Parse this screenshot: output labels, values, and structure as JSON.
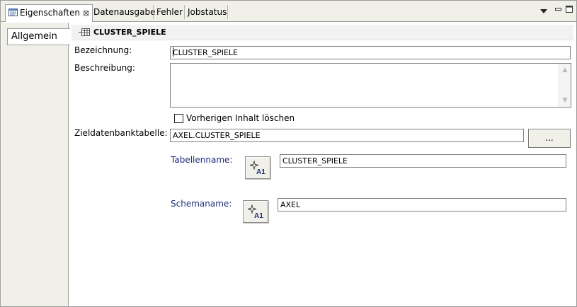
{
  "tabs": [
    {
      "label": "Eigenschaften",
      "active": true
    },
    {
      "label": "Datenausgabe",
      "active": false
    },
    {
      "label": "Fehler",
      "active": false
    },
    {
      "label": "Jobstatus",
      "active": false
    }
  ],
  "side_tabs": [
    {
      "label": "Allgemein"
    }
  ],
  "section": {
    "title": "CLUSTER_SPIELE"
  },
  "form": {
    "bezeichnung_label": "Bezeichnung:",
    "bezeichnung_value": "CLUSTER_SPIELE",
    "beschreibung_label": "Beschreibung:",
    "beschreibung_value": "",
    "checkbox_label": "Vorherigen Inhalt löschen",
    "checkbox_checked": false,
    "zieltabelle_label": "Zieldatenbanktabelle:",
    "zieltabelle_value": "AXEL.CLUSTER_SPIELE",
    "browse_label": "...",
    "tabellenname_label": "Tabellenname:",
    "tabellenname_value": "CLUSTER_SPIELE",
    "schemaname_label": "Schemaname:",
    "schemaname_value": "AXEL"
  },
  "icons": {
    "view": "properties-view-icon",
    "close": "close-icon",
    "menu": "view-menu-icon",
    "minimize": "minimize-icon",
    "maximize": "maximize-icon",
    "table": "table-icon",
    "variable": "variable-icon"
  }
}
